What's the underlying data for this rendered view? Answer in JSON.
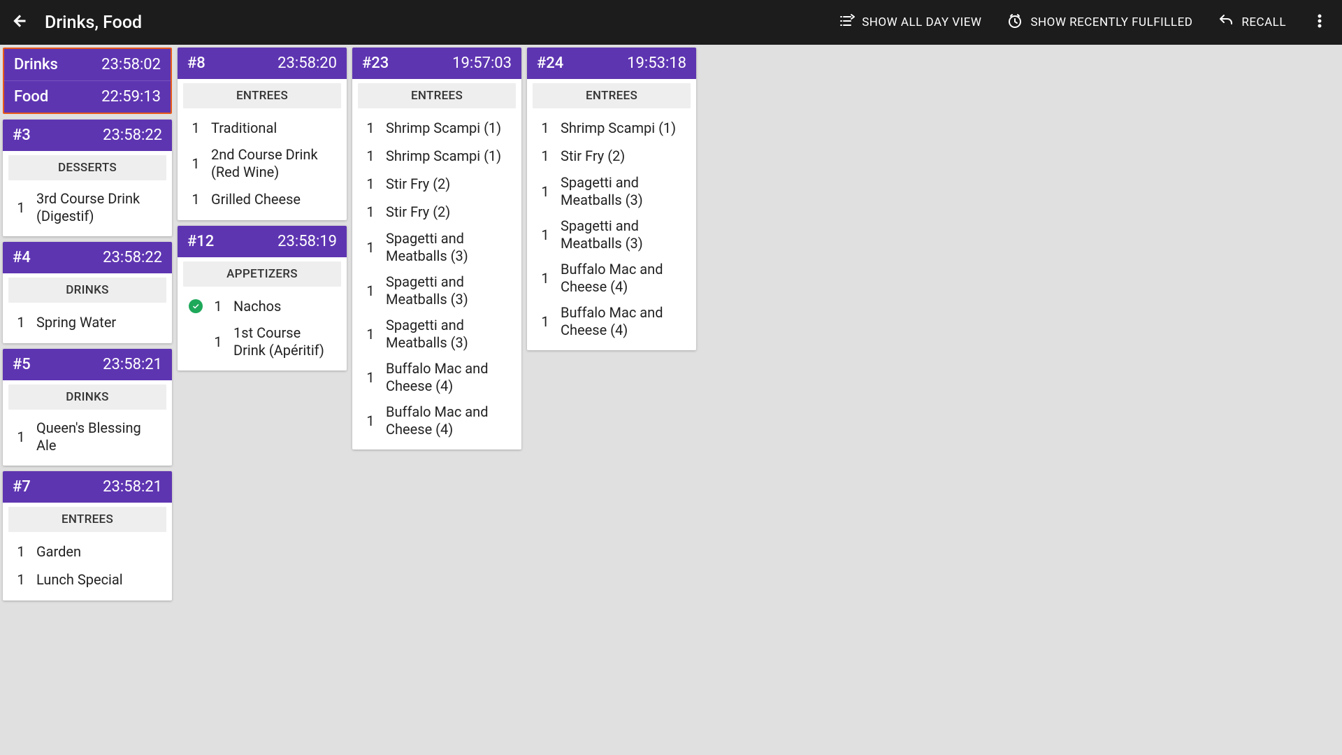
{
  "header": {
    "title": "Drinks, Food",
    "actions": {
      "show_all_day": "SHOW ALL DAY VIEW",
      "show_recent": "SHOW RECENTLY FULFILLED",
      "recall": "RECALL"
    }
  },
  "stations": {
    "drinks": {
      "label": "Drinks",
      "time": "23:58:02"
    },
    "food": {
      "label": "Food",
      "time": "22:59:13"
    }
  },
  "columns": [
    {
      "tickets": [
        {
          "id": "#3",
          "time": "23:58:22",
          "sections": [
            {
              "title": "DESSERTS",
              "items": [
                {
                  "qty": 1,
                  "name": "3rd Course Drink (Digestif)",
                  "checked": false
                }
              ]
            }
          ]
        },
        {
          "id": "#4",
          "time": "23:58:22",
          "sections": [
            {
              "title": "DRINKS",
              "items": [
                {
                  "qty": 1,
                  "name": "Spring Water",
                  "checked": false
                }
              ]
            }
          ]
        },
        {
          "id": "#5",
          "time": "23:58:21",
          "sections": [
            {
              "title": "DRINKS",
              "items": [
                {
                  "qty": 1,
                  "name": "Queen's Blessing Ale",
                  "checked": false
                }
              ]
            }
          ]
        },
        {
          "id": "#7",
          "time": "23:58:21",
          "sections": [
            {
              "title": "ENTREES",
              "items": [
                {
                  "qty": 1,
                  "name": "Garden",
                  "checked": false
                },
                {
                  "qty": 1,
                  "name": "Lunch Special",
                  "checked": false
                }
              ]
            }
          ]
        }
      ]
    },
    {
      "tickets": [
        {
          "id": "#8",
          "time": "23:58:20",
          "sections": [
            {
              "title": "ENTREES",
              "items": [
                {
                  "qty": 1,
                  "name": "Traditional",
                  "checked": false
                },
                {
                  "qty": 1,
                  "name": "2nd Course Drink (Red Wine)",
                  "checked": false
                },
                {
                  "qty": 1,
                  "name": "Grilled Cheese",
                  "checked": false
                }
              ]
            }
          ]
        },
        {
          "id": "#12",
          "time": "23:58:19",
          "sections": [
            {
              "title": "APPETIZERS",
              "items": [
                {
                  "qty": 1,
                  "name": "Nachos",
                  "checked": true
                },
                {
                  "qty": 1,
                  "name": "1st Course Drink (Apéritif)",
                  "checked": false
                }
              ]
            }
          ]
        }
      ]
    },
    {
      "tickets": [
        {
          "id": "#23",
          "time": "19:57:03",
          "sections": [
            {
              "title": "ENTREES",
              "items": [
                {
                  "qty": 1,
                  "name": "Shrimp Scampi (1)",
                  "checked": false
                },
                {
                  "qty": 1,
                  "name": "Shrimp Scampi (1)",
                  "checked": false
                },
                {
                  "qty": 1,
                  "name": "Stir Fry (2)",
                  "checked": false
                },
                {
                  "qty": 1,
                  "name": "Stir Fry (2)",
                  "checked": false
                },
                {
                  "qty": 1,
                  "name": "Spagetti and Meatballs (3)",
                  "checked": false
                },
                {
                  "qty": 1,
                  "name": "Spagetti and Meatballs (3)",
                  "checked": false
                },
                {
                  "qty": 1,
                  "name": "Spagetti and Meatballs (3)",
                  "checked": false
                },
                {
                  "qty": 1,
                  "name": "Buffalo Mac and Cheese (4)",
                  "checked": false
                },
                {
                  "qty": 1,
                  "name": "Buffalo Mac and Cheese (4)",
                  "checked": false
                }
              ]
            }
          ]
        }
      ]
    },
    {
      "tickets": [
        {
          "id": "#24",
          "time": "19:53:18",
          "sections": [
            {
              "title": "ENTREES",
              "items": [
                {
                  "qty": 1,
                  "name": "Shrimp Scampi (1)",
                  "checked": false
                },
                {
                  "qty": 1,
                  "name": "Stir Fry (2)",
                  "checked": false
                },
                {
                  "qty": 1,
                  "name": "Spagetti and Meatballs (3)",
                  "checked": false
                },
                {
                  "qty": 1,
                  "name": "Spagetti and Meatballs (3)",
                  "checked": false
                },
                {
                  "qty": 1,
                  "name": "Buffalo Mac and Cheese (4)",
                  "checked": false
                },
                {
                  "qty": 1,
                  "name": "Buffalo Mac and Cheese (4)",
                  "checked": false
                }
              ]
            }
          ]
        }
      ]
    }
  ]
}
